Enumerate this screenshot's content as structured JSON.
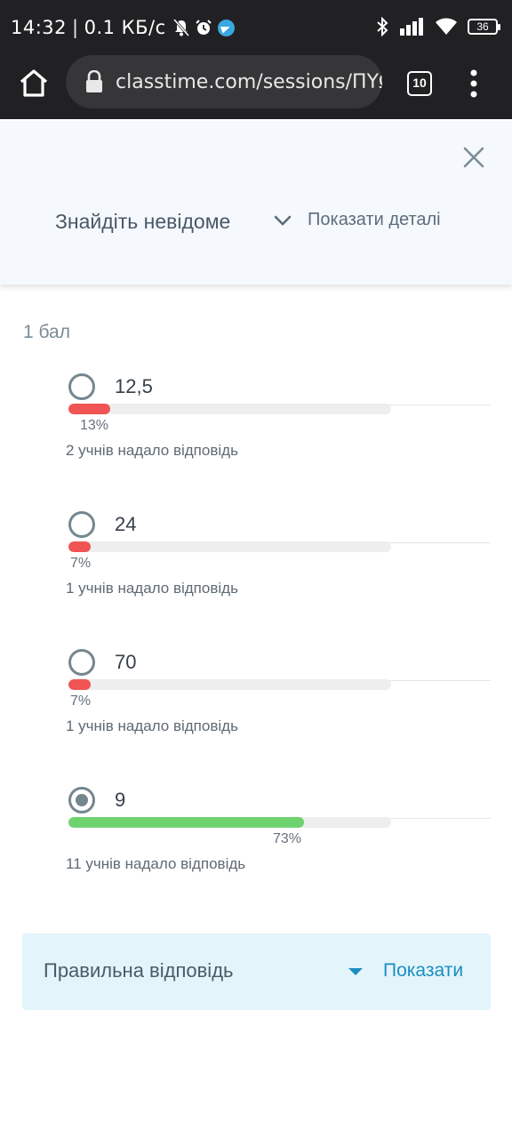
{
  "status_bar": {
    "time": "14:32",
    "separator": "|",
    "speed": "0.1 КБ/с",
    "battery": "36"
  },
  "browser": {
    "url": "classtime.com/sessions/ΠΥΩ'",
    "tab_count": "10"
  },
  "question": {
    "title": "Знайдіть невідоме",
    "details_label": "Показати деталі"
  },
  "points_label": "1 бал",
  "answers": [
    {
      "text": "12,5",
      "percent_label": "13%",
      "percent": 13,
      "count_label": "2 учнів надало відповідь",
      "selected": false,
      "status_color": "#f05454"
    },
    {
      "text": "24",
      "percent_label": "7%",
      "percent": 7,
      "count_label": "1 учнів надало відповідь",
      "selected": false,
      "status_color": "#f05454"
    },
    {
      "text": "70",
      "percent_label": "7%",
      "percent": 7,
      "count_label": "1 учнів надало відповідь",
      "selected": false,
      "status_color": "#f05454"
    },
    {
      "text": "9",
      "percent_label": "73%",
      "percent": 73,
      "count_label": "11 учнів надало відповідь",
      "selected": true,
      "status_color": "#6ed36e"
    }
  ],
  "correct_answer": {
    "label": "Правильна відповідь",
    "show_label": "Показати"
  },
  "colors": {
    "accent": "#1a8ec2",
    "incorrect": "#f05454",
    "correct": "#6ed36e"
  },
  "icons": [
    "bell-off-icon",
    "alarm-icon",
    "telegram-icon",
    "bluetooth-icon",
    "signal-icon",
    "wifi-icon",
    "battery-icon",
    "home-icon",
    "lock-icon",
    "tabs-icon",
    "more-vert-icon",
    "close-icon",
    "chevron-down-icon",
    "caret-down-icon"
  ]
}
